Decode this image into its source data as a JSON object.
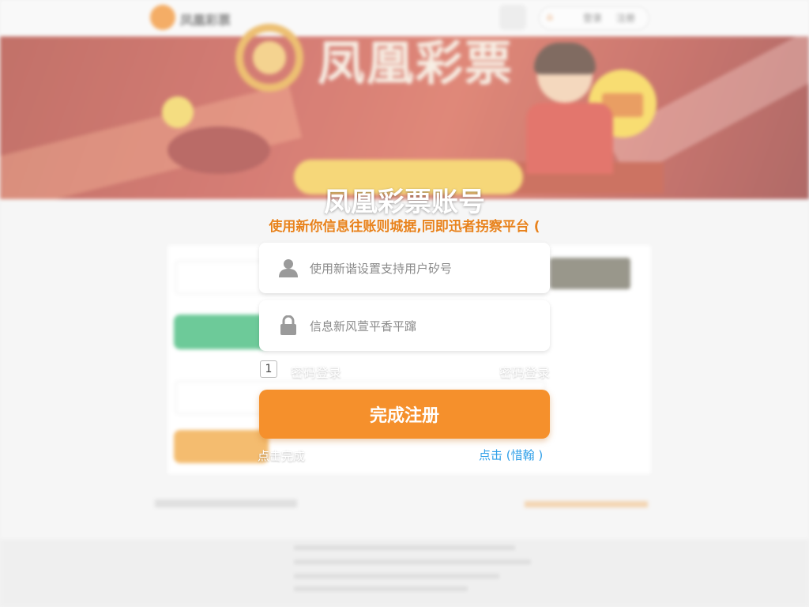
{
  "background": {
    "brand_name": "凤凰彩票",
    "banner_title": "凤凰彩票",
    "top_links": [
      "登录",
      "注册"
    ]
  },
  "modal": {
    "title": "凤凰彩票账号",
    "subtitle": "使用新你信息往账则城据,同即迅者拐察平台 (",
    "username_placeholder": "使用新谐设置支持用户矽号",
    "password_placeholder": "信息新风萱平香平蹿",
    "checkbox_value": "1",
    "checkbox_label": "密码登录",
    "right_link": "密码登录",
    "submit_label": "完成注册",
    "bottom_left": "点击完成",
    "bottom_right": "点击 (惜翰 )"
  },
  "colors": {
    "accent": "#f5902c",
    "link": "#2f9fe8",
    "subtitle": "#e8821c"
  },
  "icons": {
    "username": "user-icon",
    "password": "lock-icon"
  }
}
